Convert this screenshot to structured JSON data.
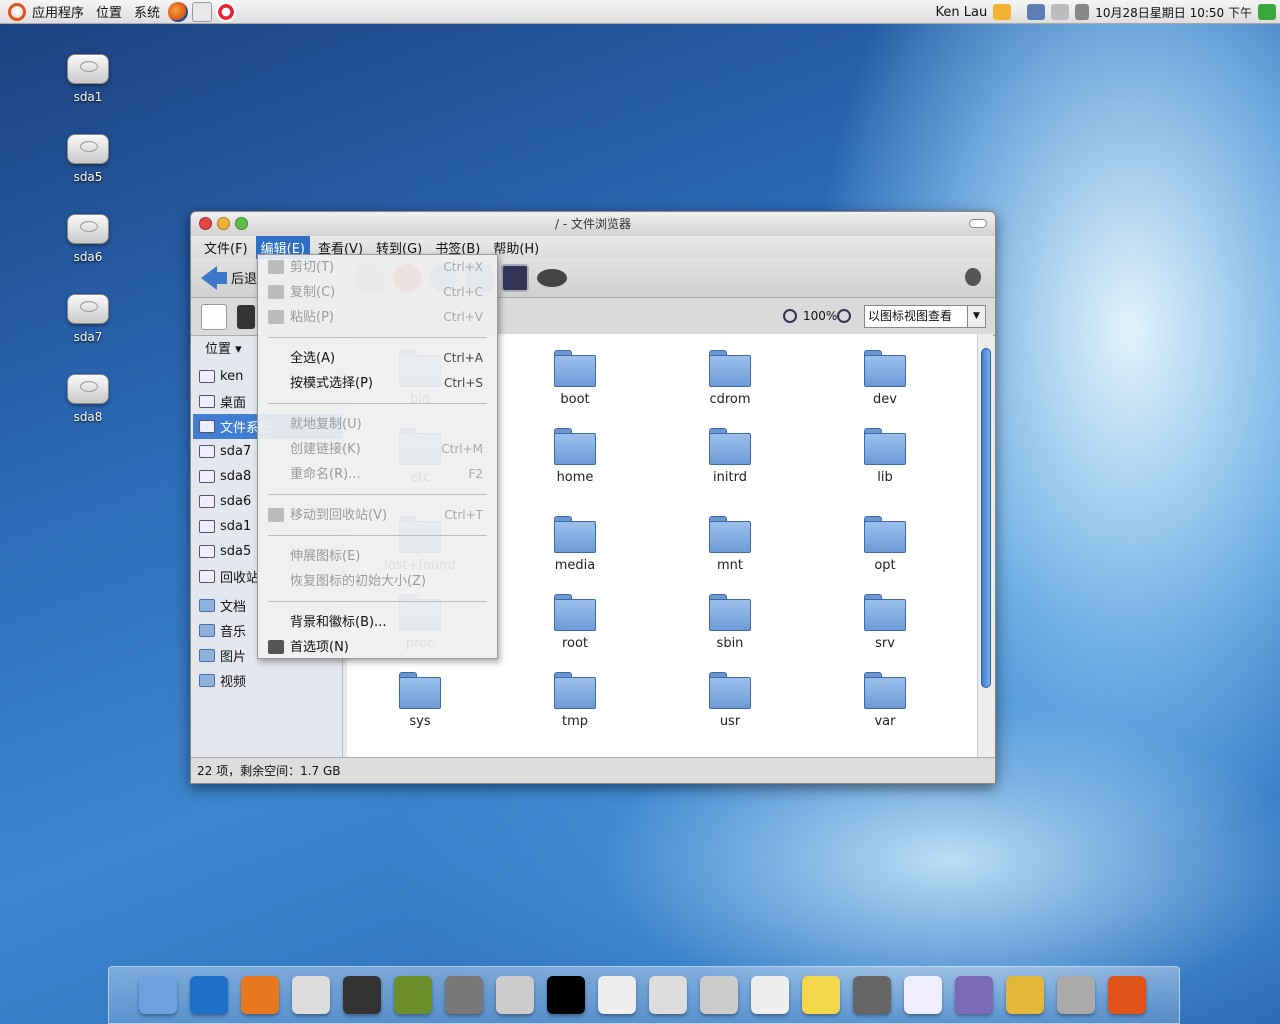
{
  "top_panel": {
    "applications": "应用程序",
    "places": "位置",
    "system": "系统",
    "user": "Ken Lau",
    "datetime": "10月28日星期日 10:50 下午"
  },
  "desktop_icons": [
    {
      "label": "sda1"
    },
    {
      "label": "sda5"
    },
    {
      "label": "sda6"
    },
    {
      "label": "sda7"
    },
    {
      "label": "sda8"
    }
  ],
  "window": {
    "title": "/ - 文件浏览器",
    "menu": {
      "file": "文件(F)",
      "edit": "编辑(E)",
      "view": "查看(V)",
      "go": "转到(G)",
      "bookmarks": "书签(B)",
      "help": "帮助(H)"
    },
    "toolbar": {
      "back": "后退"
    },
    "zoom": "100%",
    "view_mode": "以图标视图查看",
    "sidebar": {
      "header": "位置",
      "items": [
        "ken",
        "桌面",
        "文件系统",
        "sda7",
        "sda8",
        "sda6",
        "sda1",
        "sda5",
        "回收站",
        "文档",
        "音乐",
        "图片",
        "视频"
      ]
    },
    "folders": [
      "bin",
      "boot",
      "cdrom",
      "dev",
      "etc",
      "home",
      "initrd",
      "lib",
      "lost+found",
      "media",
      "mnt",
      "opt",
      "proc",
      "root",
      "sbin",
      "srv",
      "sys",
      "tmp",
      "usr",
      "var"
    ],
    "status": "22 项，剩余空间：1.7 GB"
  },
  "edit_menu": [
    {
      "label": "剪切(T)",
      "accel": "Ctrl+X"
    },
    {
      "label": "复制(C)",
      "accel": "Ctrl+C"
    },
    {
      "label": "粘贴(P)",
      "accel": "Ctrl+V"
    },
    {
      "label": "全选(A)",
      "accel": "Ctrl+A"
    },
    {
      "label": "按模式选择(P)",
      "accel": "Ctrl+S"
    },
    {
      "label": "就地复制(U)",
      "accel": ""
    },
    {
      "label": "创建链接(K)",
      "accel": "Ctrl+M"
    },
    {
      "label": "重命名(R)...",
      "accel": "F2"
    },
    {
      "label": "移动到回收站(V)",
      "accel": "Ctrl+T"
    },
    {
      "label": "伸展图标(E)",
      "accel": ""
    },
    {
      "label": "恢复图标的初始大小(Z)",
      "accel": ""
    },
    {
      "label": "背景和徽标(B)...",
      "accel": ""
    },
    {
      "label": "首选项(N)",
      "accel": ""
    }
  ],
  "colors": {
    "accent": "#2f6fc6",
    "folder": "#8fb2dd",
    "selection": "#3f7ed0"
  }
}
